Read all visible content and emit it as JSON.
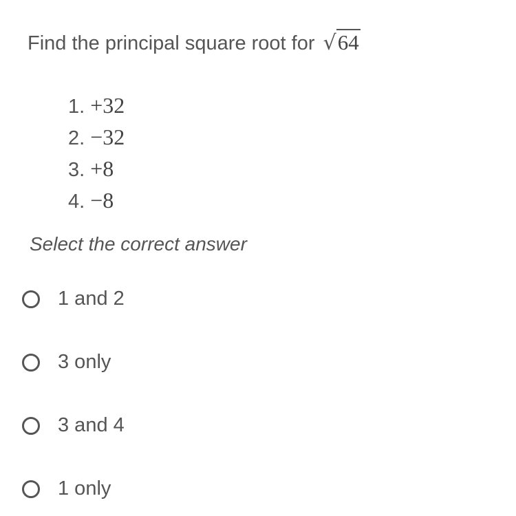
{
  "question": {
    "text": "Find the principal square root for",
    "radical_symbol": "√",
    "radicand": "64"
  },
  "statements": [
    {
      "number": "1.",
      "value": "+32"
    },
    {
      "number": "2.",
      "value": "−32"
    },
    {
      "number": "3.",
      "value": "+8"
    },
    {
      "number": "4.",
      "value": "−8"
    }
  ],
  "prompt": "Select the correct answer",
  "options": [
    {
      "label": "1 and 2",
      "selected": false
    },
    {
      "label": "3 only",
      "selected": false
    },
    {
      "label": "3 and 4",
      "selected": false
    },
    {
      "label": "1 only",
      "selected": false
    }
  ]
}
